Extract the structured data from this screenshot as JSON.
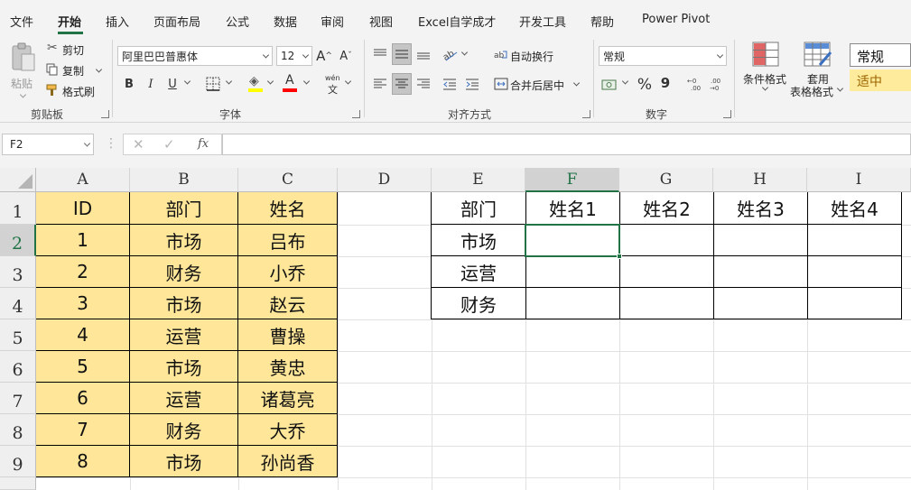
{
  "menu": {
    "tabs": [
      "文件",
      "开始",
      "插入",
      "页面布局",
      "公式",
      "数据",
      "审阅",
      "视图",
      "Excel自学成才",
      "开发工具",
      "帮助",
      "Power Pivot"
    ],
    "active_index": 1
  },
  "ribbon": {
    "clipboard": {
      "paste": "粘贴",
      "cut": "剪切",
      "copy": "复制",
      "format_painter": "格式刷",
      "group": "剪贴板"
    },
    "font": {
      "name": "阿里巴巴普惠体",
      "size": "12",
      "bold": "B",
      "italic": "I",
      "underline": "U",
      "increase": "A",
      "decrease": "A",
      "phonetic": "wén",
      "group": "字体"
    },
    "alignment": {
      "wrap": "自动换行",
      "merge": "合并后居中",
      "group": "对齐方式"
    },
    "number": {
      "format": "常规",
      "percent": "%",
      "comma": "9",
      "group": "数字"
    },
    "styles": {
      "conditional": "条件格式",
      "table_line1": "套用",
      "table_line2": "表格格式",
      "style_normal": "常规",
      "style_neutral": "适中"
    }
  },
  "formula_bar": {
    "cell_ref": "F2",
    "fx": "fx",
    "value": ""
  },
  "colors": {
    "accent": "#217346",
    "yellow_fill": "#ffe699",
    "font_red": "#ff0000",
    "fill_yellow": "#ffff00"
  },
  "sheet": {
    "columns": [
      "A",
      "B",
      "C",
      "D",
      "E",
      "F",
      "G",
      "H",
      "I"
    ],
    "rows": [
      "1",
      "2",
      "3",
      "4",
      "5",
      "6",
      "7",
      "8",
      "9"
    ],
    "selected_cell": "F2",
    "source_table": [
      [
        "ID",
        "部门",
        "姓名"
      ],
      [
        "1",
        "市场",
        "吕布"
      ],
      [
        "2",
        "财务",
        "小乔"
      ],
      [
        "3",
        "市场",
        "赵云"
      ],
      [
        "4",
        "运营",
        "曹操"
      ],
      [
        "5",
        "市场",
        "黄忠"
      ],
      [
        "6",
        "运营",
        "诸葛亮"
      ],
      [
        "7",
        "财务",
        "大乔"
      ],
      [
        "8",
        "市场",
        "孙尚香"
      ]
    ],
    "result_table": [
      [
        "部门",
        "姓名1",
        "姓名2",
        "姓名3",
        "姓名4"
      ],
      [
        "市场",
        "",
        "",
        "",
        ""
      ],
      [
        "运营",
        "",
        "",
        "",
        ""
      ],
      [
        "财务",
        "",
        "",
        "",
        ""
      ]
    ]
  }
}
